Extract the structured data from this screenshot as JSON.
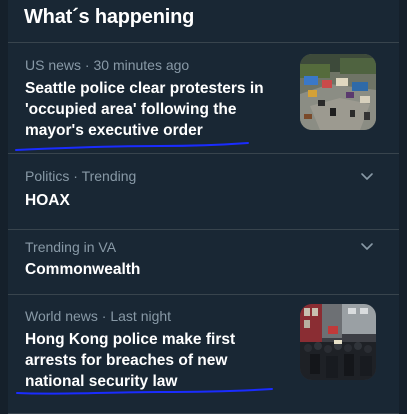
{
  "section": {
    "title": "What´s happening"
  },
  "items": [
    {
      "category": "US news",
      "separator": "·",
      "time": "30 minutes ago",
      "headline_lines": [
        "Seattle police clear protesters in",
        "'occupied area' following the",
        "mayor's executive order"
      ],
      "thumbnail": "protest-camp-photo"
    },
    {
      "category": "Politics",
      "separator": "·",
      "context": "Trending",
      "topic": "HOAX",
      "menu_icon": "chevron-down-icon"
    },
    {
      "context": "Trending in VA",
      "topic": "Commonwealth",
      "menu_icon": "chevron-down-icon"
    },
    {
      "category": "World news",
      "separator": "·",
      "time": "Last night",
      "headline_lines": [
        "Hong Kong police make first",
        "arrests for breaches of new",
        "national security law"
      ],
      "thumbnail": "police-crowd-photo"
    }
  ],
  "annotation": {
    "color": "#1a2cff"
  },
  "colors": {
    "background": "#15202b",
    "panel": "#192734",
    "divider": "#38444d",
    "secondary_text": "#8899a6",
    "primary_text": "#ffffff"
  }
}
